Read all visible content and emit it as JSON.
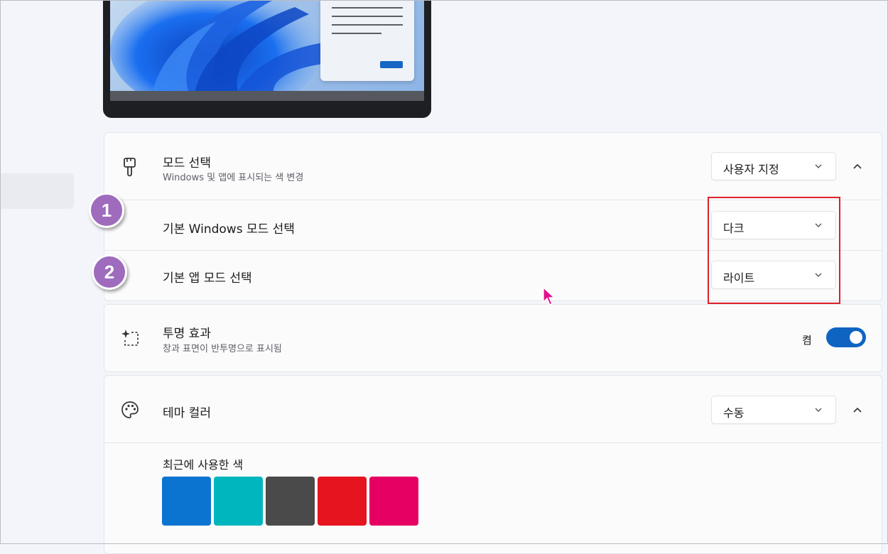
{
  "mode_section": {
    "title": "모드 선택",
    "subtitle": "Windows 및 앱에 표시되는 색 변경",
    "selected": "사용자 지정",
    "windows_mode": {
      "label": "기본 Windows 모드 선택",
      "value": "다크"
    },
    "app_mode": {
      "label": "기본 앱 모드 선택",
      "value": "라이트"
    }
  },
  "transparency": {
    "title": "투명 효과",
    "subtitle": "창과 표면이 반투명으로 표시됨",
    "state_label": "켬",
    "on": true
  },
  "theme_color": {
    "title": "테마 컬러",
    "selected": "수동",
    "recent_label": "최근에 사용한 색",
    "recent_colors": [
      "#0b74d1",
      "#00b6be",
      "#4a4a4a",
      "#e5141e",
      "#e60063"
    ]
  },
  "callouts": [
    "1",
    "2"
  ],
  "colors": {
    "accent": "#0f64c2",
    "highlight": "#e0202a",
    "badge": "#9e6bbd"
  }
}
